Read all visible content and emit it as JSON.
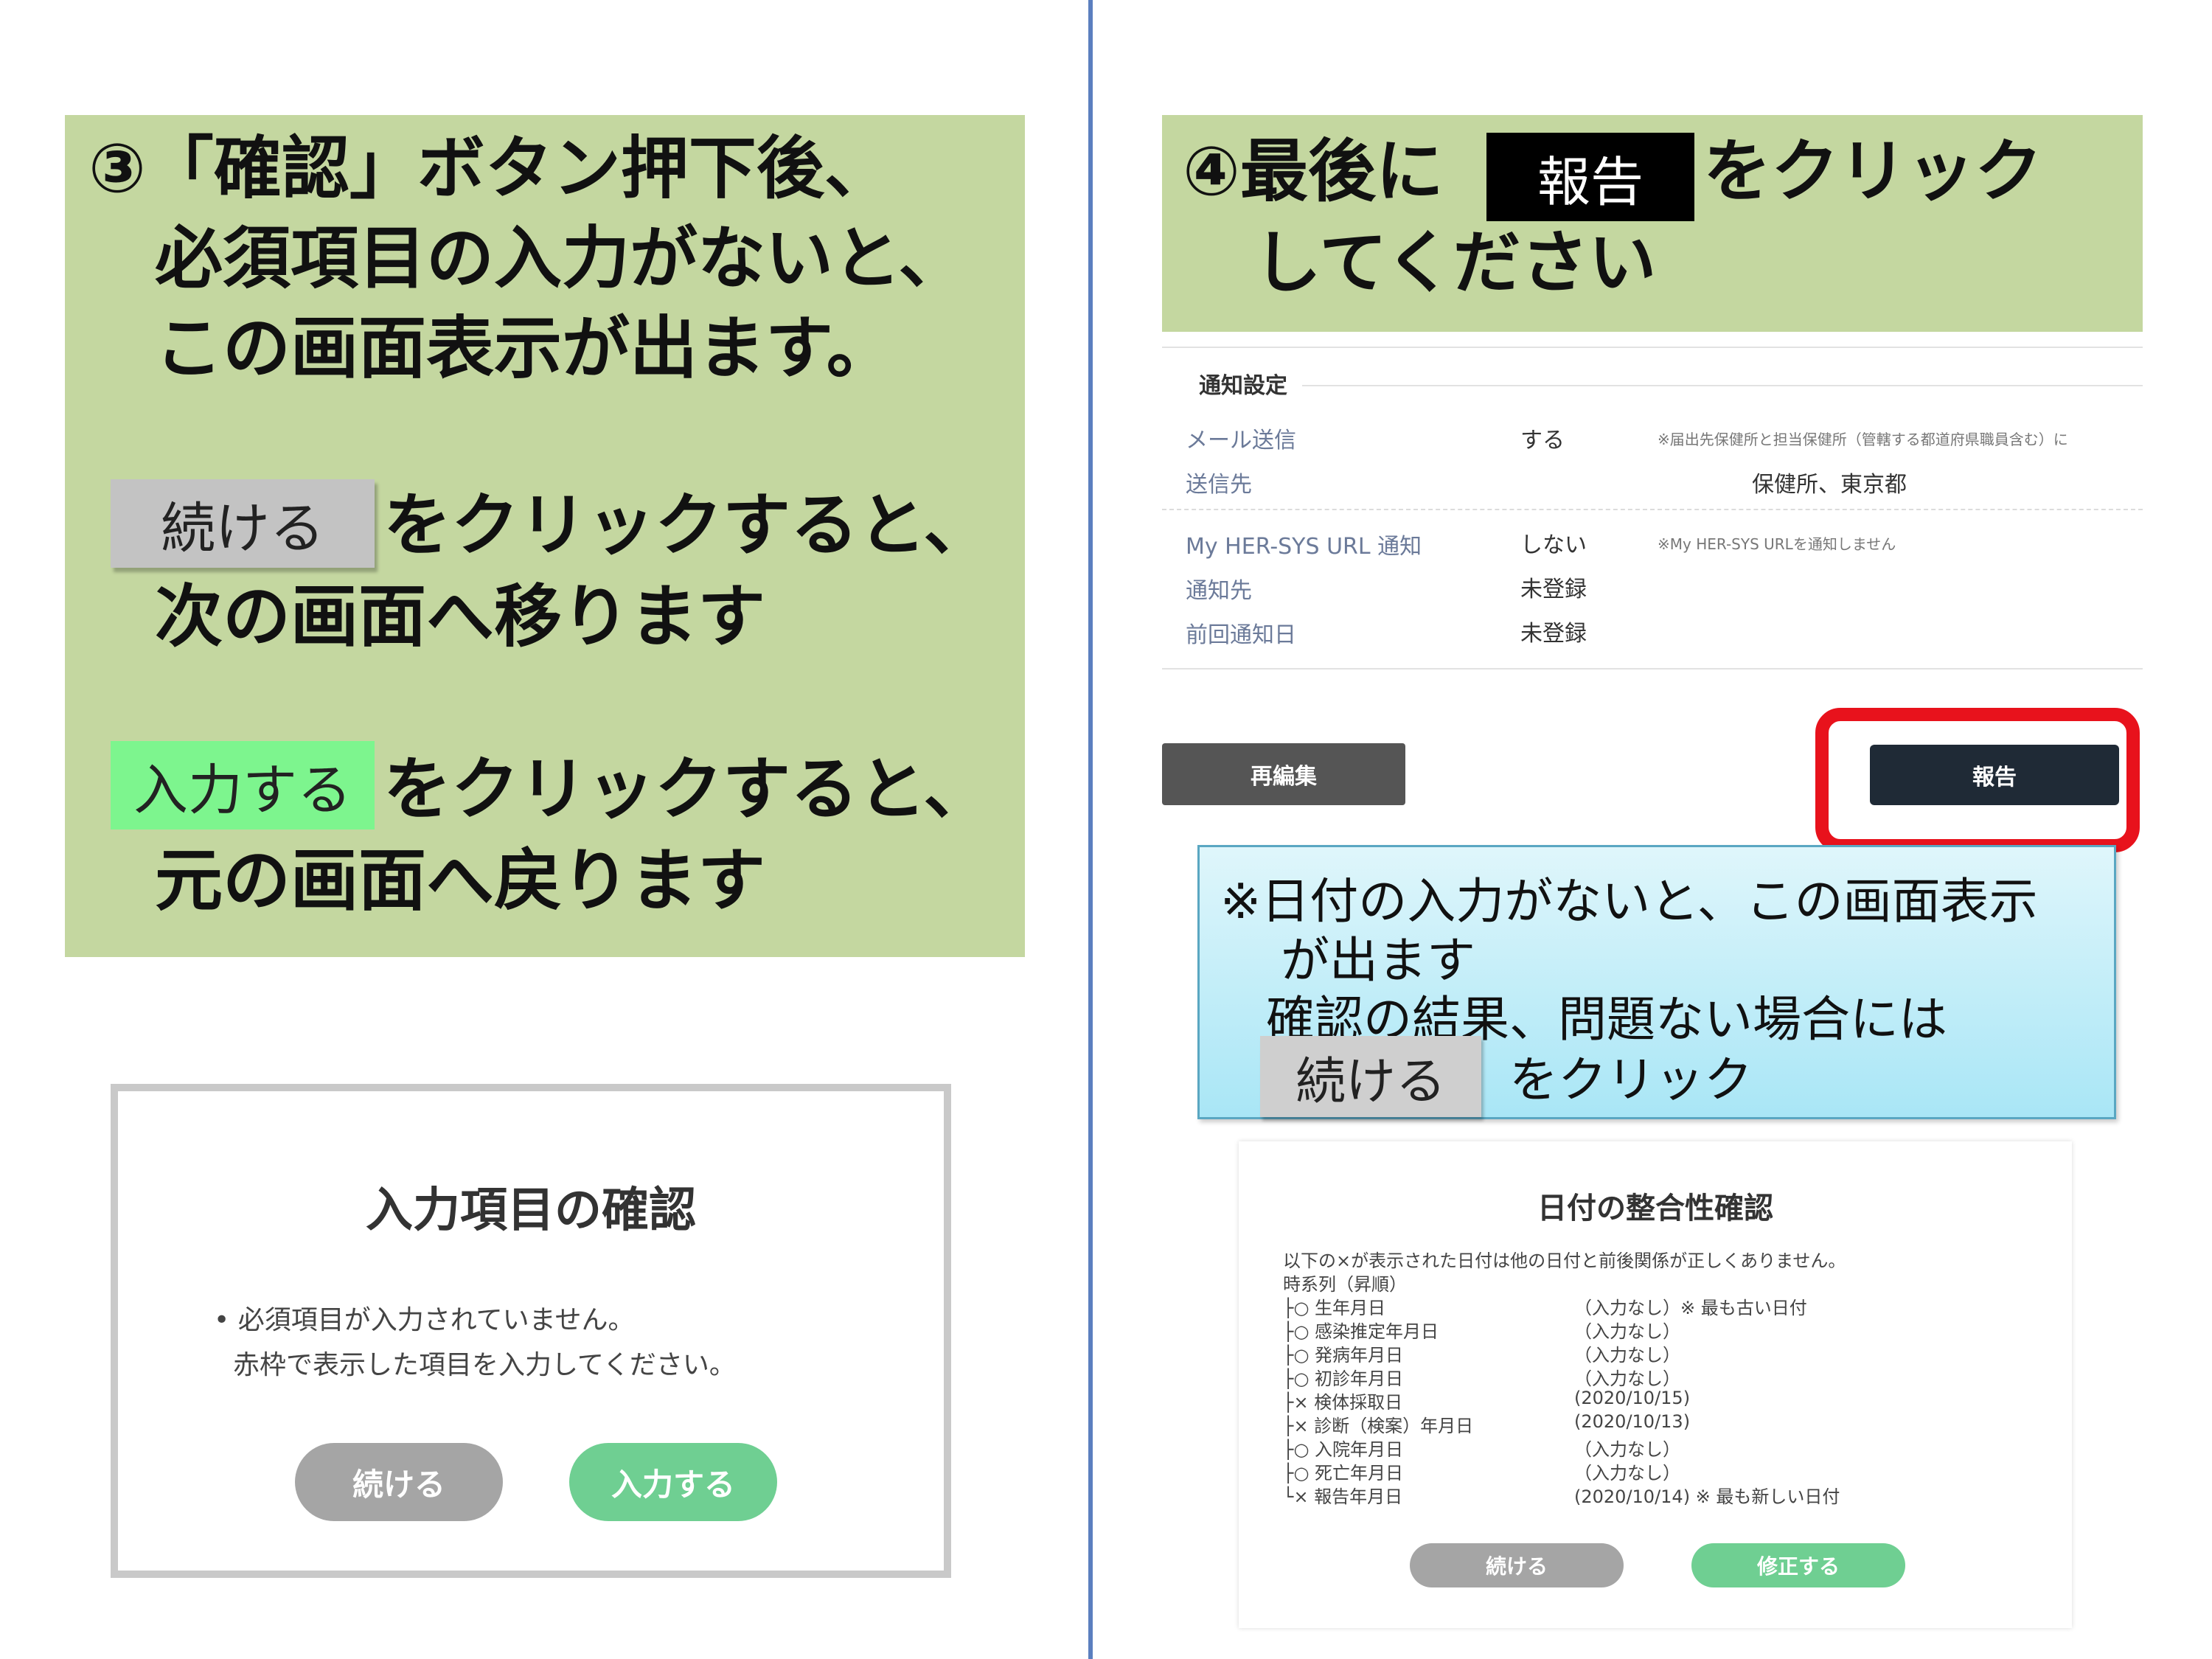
{
  "left": {
    "heading_lines": [
      "③「確認」ボタン押下後、",
      "必須項目の入力がないと、",
      "この画面表示が出ます。"
    ],
    "continue_chip": "続ける",
    "continue_text_line1": "をクリックすると、",
    "continue_text_line2": "次の画面へ移ります",
    "input_chip": "入力する",
    "input_text_line1": "をクリックすると、",
    "input_text_line2": "元の画面へ戻ります",
    "dialog": {
      "title": "入力項目の確認",
      "bullet": "•",
      "message_line1": "必須項目が入力されていません。",
      "message_line2": "赤枠で表示した項目を入力してください。",
      "continue_button": "続ける",
      "input_button": "入力する"
    }
  },
  "right": {
    "heading_prefix": "④最後に",
    "heading_chip": "報告",
    "heading_suffix": "をクリック",
    "heading_line2": "してください",
    "settings": {
      "section_title": "通知設定",
      "mail_label": "メール送信",
      "mail_value": "する",
      "mail_note": "※届出先保健所と担当保健所（管轄する都道府県職員含む）に",
      "dest_label": "送信先",
      "dest_value": "保健所、東京都",
      "url_label": "My HER-SYS URL 通知",
      "url_value": "しない",
      "url_note": "※My HER-SYS URLを通知しません",
      "notify_label": "通知先",
      "notify_value": "未登録",
      "last_label": "前回通知日",
      "last_value": "未登録"
    },
    "reedit_button": "再編集",
    "report_button": "報告",
    "note": {
      "line1": "※日付の入力がないと、この画面表示",
      "line2": "が出ます",
      "line3": "確認の結果、問題ない場合には",
      "chip": "続ける",
      "line4": "をクリック"
    },
    "date_check": {
      "title": "日付の整合性確認",
      "desc": "以下の×が表示された日付は他の日付と前後関係が正しくありません。",
      "order": "時系列（昇順）",
      "rows": [
        {
          "label": "├○ 生年月日",
          "value": "（入力なし）※ 最も古い日付"
        },
        {
          "label": "├○ 感染推定年月日",
          "value": "（入力なし）"
        },
        {
          "label": "├○ 発病年月日",
          "value": "（入力なし）"
        },
        {
          "label": "├○ 初診年月日",
          "value": "（入力なし）"
        },
        {
          "label": "├× 検体採取日",
          "value": "(2020/10/15)"
        },
        {
          "label": "├× 診断（検案）年月日",
          "value": "(2020/10/13)"
        },
        {
          "label": "├○ 入院年月日",
          "value": "（入力なし）"
        },
        {
          "label": "├○ 死亡年月日",
          "value": "（入力なし）"
        },
        {
          "label": "└× 報告年月日",
          "value": "(2020/10/14) ※ 最も新しい日付"
        }
      ],
      "continue_button": "続ける",
      "fix_button": "修正する"
    }
  },
  "colors": {
    "panel_green": "#c4d7a0",
    "divider_blue": "#5b7fbf",
    "alert_red": "#e8121c",
    "pill_green": "#6fcf92",
    "pill_grey": "#a5a5a5",
    "report_navy": "#1f2a36"
  }
}
